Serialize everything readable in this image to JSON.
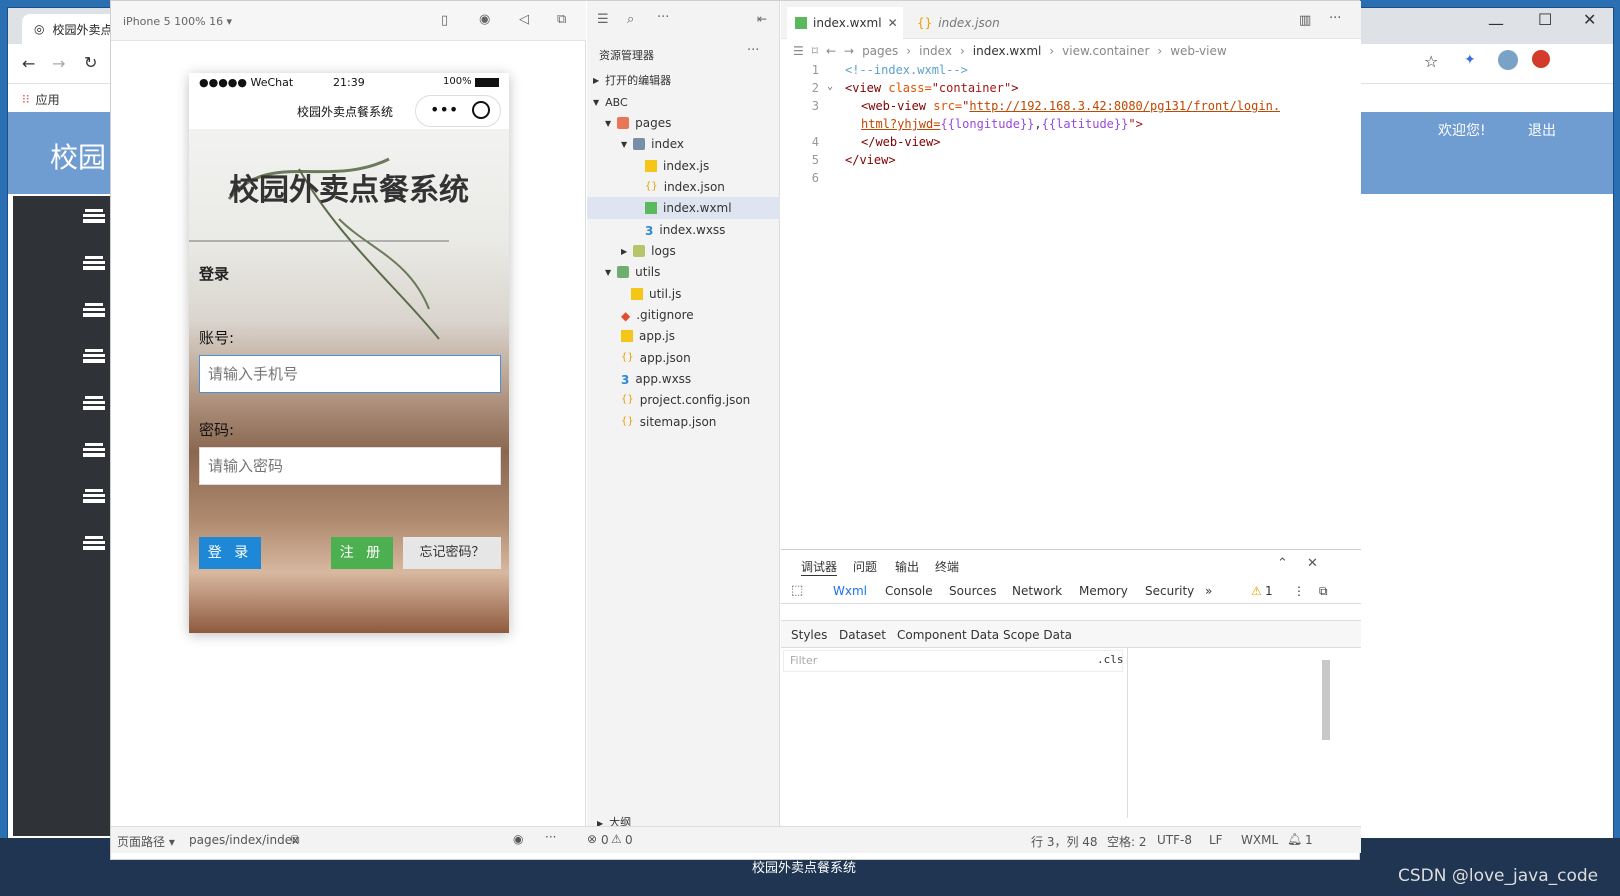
{
  "browser": {
    "tab_title": "校园外卖点",
    "bookmarks_label": "应用",
    "window_controls": [
      "—",
      "☐",
      "✕"
    ]
  },
  "site": {
    "title": "校园",
    "welcome": "欢迎您!",
    "logout": "退出",
    "footer": "校园外卖点餐系统"
  },
  "simulator": {
    "device": "iPhone 5 100% 16 ▾",
    "status_carrier": "●●●●● WeChat",
    "status_time": "21:39",
    "status_battery": "100%",
    "nav_title": "校园外卖点餐系统",
    "app_title": "校园外卖点餐系统",
    "login_heading": "登录",
    "account_label": "账号:",
    "account_placeholder": "请输入手机号",
    "password_label": "密码:",
    "password_placeholder": "请输入密码",
    "login_button": "登 录",
    "register_button": "注 册",
    "forgot_button": "忘记密码？"
  },
  "explorer": {
    "title": "资源管理器",
    "open_editors": "打开的编辑器",
    "project": "ABC",
    "outline": "大纲",
    "tree": [
      {
        "label": "pages"
      },
      {
        "label": "index"
      },
      {
        "label": "index.js"
      },
      {
        "label": "index.json"
      },
      {
        "label": "index.wxml"
      },
      {
        "label": "index.wxss"
      },
      {
        "label": "logs"
      },
      {
        "label": "utils"
      },
      {
        "label": "util.js"
      },
      {
        "label": ".gitignore"
      },
      {
        "label": "app.js"
      },
      {
        "label": "app.json"
      },
      {
        "label": "app.wxss"
      },
      {
        "label": "project.config.json"
      },
      {
        "label": "sitemap.json"
      }
    ]
  },
  "editor": {
    "tab_active": "index.wxml",
    "tab_other": "index.json",
    "breadcrumbs": [
      "pages",
      "index",
      "index.wxml",
      "view.container",
      "web-view"
    ],
    "line_numbers": [
      "1",
      "2",
      "3",
      "",
      "4",
      "5",
      "6"
    ],
    "code": {
      "l1": "<!--index.wxml-->",
      "l2_tag": "<view",
      "l2_attr": " class=",
      "l2_val": "\"container\"",
      "l2_end": ">",
      "l3_tag": "<web-view",
      "l3_attr": " src=",
      "l3_q": "\"",
      "l3_url": "http://192.168.3.42:8080/pg131/front/login.",
      "l3b_url": "html?yhjwd=",
      "l3b_b1": "{{longitude}}",
      "l3b_c": ",",
      "l3b_b2": "{{latitude}}",
      "l3b_end": "\">",
      "l4": "</web-view>",
      "l5": "</view>"
    }
  },
  "debugger": {
    "tabs": [
      "调试器",
      "问题",
      "输出",
      "终端"
    ],
    "devtools_tabs": [
      "Wxml",
      "Console",
      "Sources",
      "Network",
      "Memory",
      "Security"
    ],
    "warning_count": "1",
    "styles_tabs": [
      "Styles",
      "Dataset",
      "Component Data",
      "Scope Data"
    ],
    "filter_placeholder": "Filter",
    "cls": ".cls"
  },
  "statusbar": {
    "page_path_label": "页面路径 ▾",
    "page_path": "pages/index/index",
    "errors": "0",
    "warnings": "0",
    "position": "行 3，列 48",
    "spaces": "空格: 2",
    "encoding": "UTF-8",
    "eol": "LF",
    "language": "WXML",
    "notifications": "1"
  },
  "watermark": "CSDN @love_java_code"
}
